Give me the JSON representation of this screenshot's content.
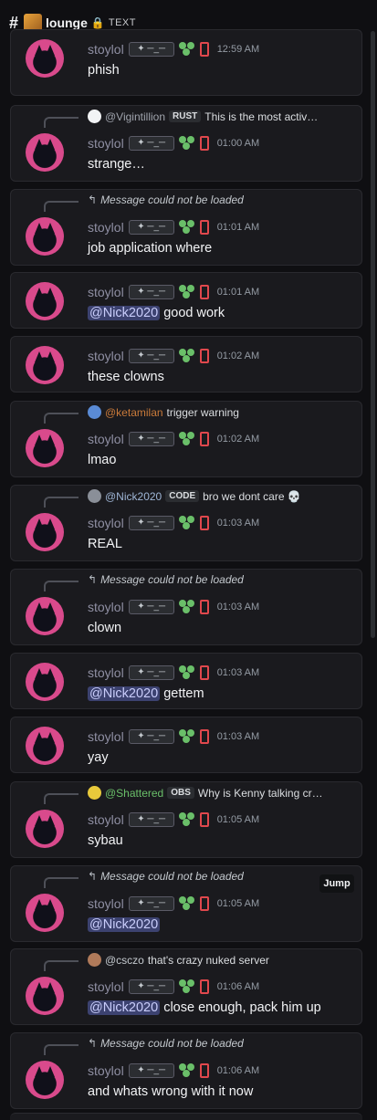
{
  "header": {
    "hash": "#",
    "channel_name": "lounge",
    "channel_suffix": "TEXT",
    "lock_icon": "🔒"
  },
  "colors": {
    "background": "#0f0f12",
    "card": "#1a1a1e",
    "username": "#8f8fa3",
    "mention_bg": "#3c4270",
    "clover": "#6abf69",
    "phone": "#e0484d"
  },
  "messages": [
    {
      "top": 0,
      "reply": null,
      "username": "stoylol",
      "tag": "✦ ─_─",
      "time": "12:59 AM",
      "content": [
        {
          "text": "phish"
        }
      ]
    },
    {
      "reply": {
        "type": "user",
        "name": "@Vigintillion",
        "name_color": "#a0a4ad",
        "role": "RUST",
        "text": "This is the most activ…",
        "avatar_color": "#f2f3f5"
      },
      "username": "stoylol",
      "tag": "✦ ─_─",
      "time": "01:00 AM",
      "content": [
        {
          "text": "strange…"
        }
      ]
    },
    {
      "reply": {
        "type": "missing",
        "text": "Message could not be loaded"
      },
      "username": "stoylol",
      "tag": "✦ ─_─",
      "time": "01:01 AM",
      "content": [
        {
          "text": "job application where"
        }
      ]
    },
    {
      "reply": null,
      "username": "stoylol",
      "tag": "✦ ─_─",
      "time": "01:01 AM",
      "content": [
        {
          "text": "@Nick2020",
          "mention": true
        },
        {
          "text": " good work"
        }
      ]
    },
    {
      "reply": null,
      "username": "stoylol",
      "tag": "✦ ─_─",
      "time": "01:02 AM",
      "content": [
        {
          "text": "these clowns"
        }
      ]
    },
    {
      "reply": {
        "type": "user",
        "name": "@ketamilan",
        "name_color": "#c97a3a",
        "role": "",
        "text": "trigger warning",
        "avatar_color": "#5a8bd6"
      },
      "username": "stoylol",
      "tag": "✦ ─_─",
      "time": "01:02 AM",
      "content": [
        {
          "text": "lmao"
        }
      ]
    },
    {
      "reply": {
        "type": "user",
        "name": "@Nick2020",
        "name_color": "#9fb6d6",
        "role": "CODE",
        "text": "bro we dont care 💀",
        "avatar_color": "#8a8f98"
      },
      "username": "stoylol",
      "tag": "✦ ─_─",
      "time": "01:03 AM",
      "content": [
        {
          "text": "REAL"
        }
      ]
    },
    {
      "reply": {
        "type": "missing",
        "text": "Message could not be loaded"
      },
      "username": "stoylol",
      "tag": "✦ ─_─",
      "time": "01:03 AM",
      "content": [
        {
          "text": "clown"
        }
      ]
    },
    {
      "reply": null,
      "username": "stoylol",
      "tag": "✦ ─_─",
      "time": "01:03 AM",
      "content": [
        {
          "text": "@Nick2020",
          "mention": true
        },
        {
          "text": "  gettem"
        }
      ]
    },
    {
      "reply": null,
      "username": "stoylol",
      "tag": "✦ ─_─",
      "time": "01:03 AM",
      "content": [
        {
          "text": "yay"
        }
      ]
    },
    {
      "reply": {
        "type": "user",
        "name": "@Shattered",
        "name_color": "#6abf69",
        "role": "OBS",
        "text": "Why is Kenny talking cr…",
        "avatar_color": "#e8c93b"
      },
      "username": "stoylol",
      "tag": "✦ ─_─",
      "time": "01:05 AM",
      "content": [
        {
          "text": "sybau"
        }
      ]
    },
    {
      "reply": {
        "type": "missing",
        "text": "Message could not be loaded"
      },
      "jump": "Jump",
      "username": "stoylol",
      "tag": "✦ ─_─",
      "time": "01:05 AM",
      "content": [
        {
          "text": "@Nick2020",
          "mention": true
        }
      ]
    },
    {
      "reply": {
        "type": "user",
        "name": "@csczo",
        "name_color": "#c4c9ce",
        "role": "",
        "text": "that's crazy nuked server",
        "avatar_color": "#b07a5a"
      },
      "username": "stoylol",
      "tag": "✦ ─_─",
      "time": "01:06 AM",
      "content": [
        {
          "text": "@Nick2020",
          "mention": true
        },
        {
          "text": " close enough, pack him up"
        }
      ]
    },
    {
      "reply": {
        "type": "missing",
        "text": "Message could not be loaded"
      },
      "username": "stoylol",
      "tag": "✦ ─_─",
      "time": "01:06 AM",
      "content": [
        {
          "text": "and whats wrong with it now"
        }
      ]
    }
  ]
}
